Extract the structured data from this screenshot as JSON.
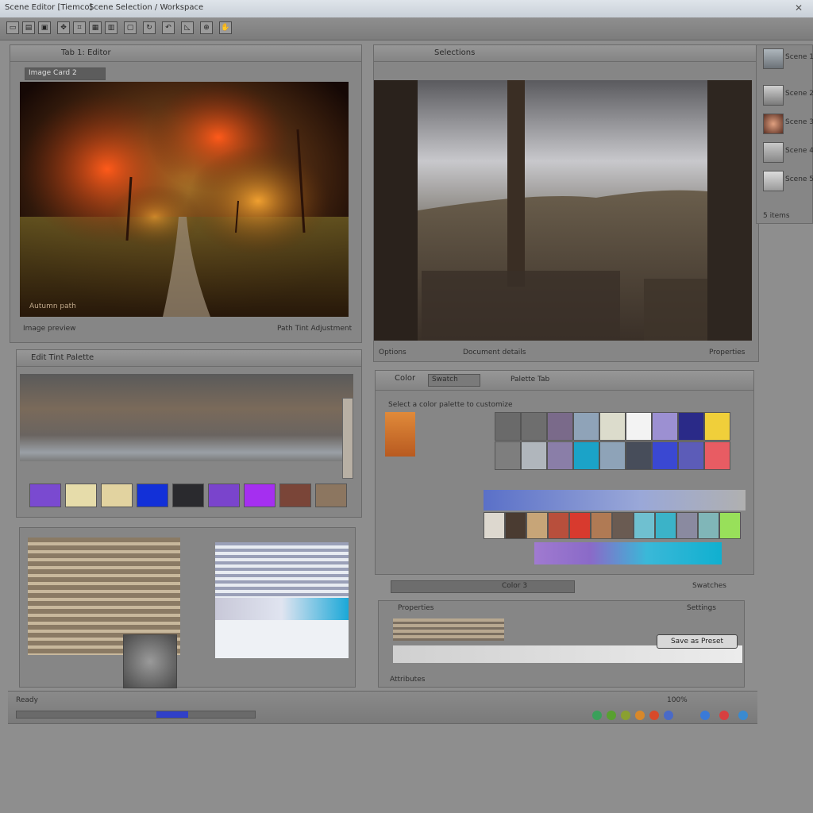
{
  "window": {
    "title": "Scene Editor [Tiemco]",
    "subtitle": "Scene Selection / Workspace"
  },
  "panels": {
    "left_viewer": {
      "tab": "Tab 1: Editor",
      "field": "Image Card 2",
      "caption": "Autumn path",
      "footer_left": "Image preview",
      "footer_right": "Path Tint Adjustment"
    },
    "right_viewer": {
      "tab": "Selections",
      "footer_left": "Options",
      "footer_center": "Document details",
      "footer_right": "Properties"
    },
    "palette_editor": {
      "header": "Edit Tint Palette",
      "swatches": [
        "#7a4ad0",
        "#e6dcaa",
        "#e2d3a0",
        "#1230d8",
        "#2a2a2e",
        "#7a44cc",
        "#a52ff0",
        "#7a4538",
        "#8c7660"
      ]
    },
    "color_panel": {
      "tab_label": "Color",
      "dropdown": "Swatch",
      "tab_right": "Palette Tab",
      "row_label": "Select a color palette to customize",
      "grid": [
        [
          "#6a6a6a",
          "#6e6e6e",
          "#7a6a8a",
          "#8fa3b8",
          "#dcdccc",
          "#f3f3f3",
          "#9c90d2",
          "#2a2a88",
          "#f0cf3a"
        ],
        [
          "#7e7e7e",
          "#b0b6bc",
          "#8a7ea8",
          "#1ba3c8",
          "#8ea3b8",
          "#474d5a",
          "#3a48d2",
          "#5c5cb8",
          "#e85c63"
        ]
      ],
      "row2": [
        "#ddd8cf",
        "#4a3b31",
        "#c7a578",
        "#b84f3c",
        "#d83a2e",
        "#b07a54",
        "#6a5b52",
        "#6fc0d0",
        "#3bb3c8",
        "#8a8aa0",
        "#80b6b8",
        "#98e05a"
      ],
      "status": "Color 3",
      "status_right": "Swatches"
    },
    "bottom_panel": {
      "label": "Properties",
      "side_label": "Settings",
      "button": "Save as Preset",
      "foot": "Attributes"
    }
  },
  "thumbnails": {
    "items": [
      {
        "label": "Scene 1"
      },
      {
        "label": "Scene 2"
      },
      {
        "label": "Scene 3"
      },
      {
        "label": "Scene 4"
      },
      {
        "label": "Scene 5"
      }
    ],
    "footer": "5 items"
  },
  "statusbar": {
    "left": "Ready",
    "right": "100%"
  }
}
